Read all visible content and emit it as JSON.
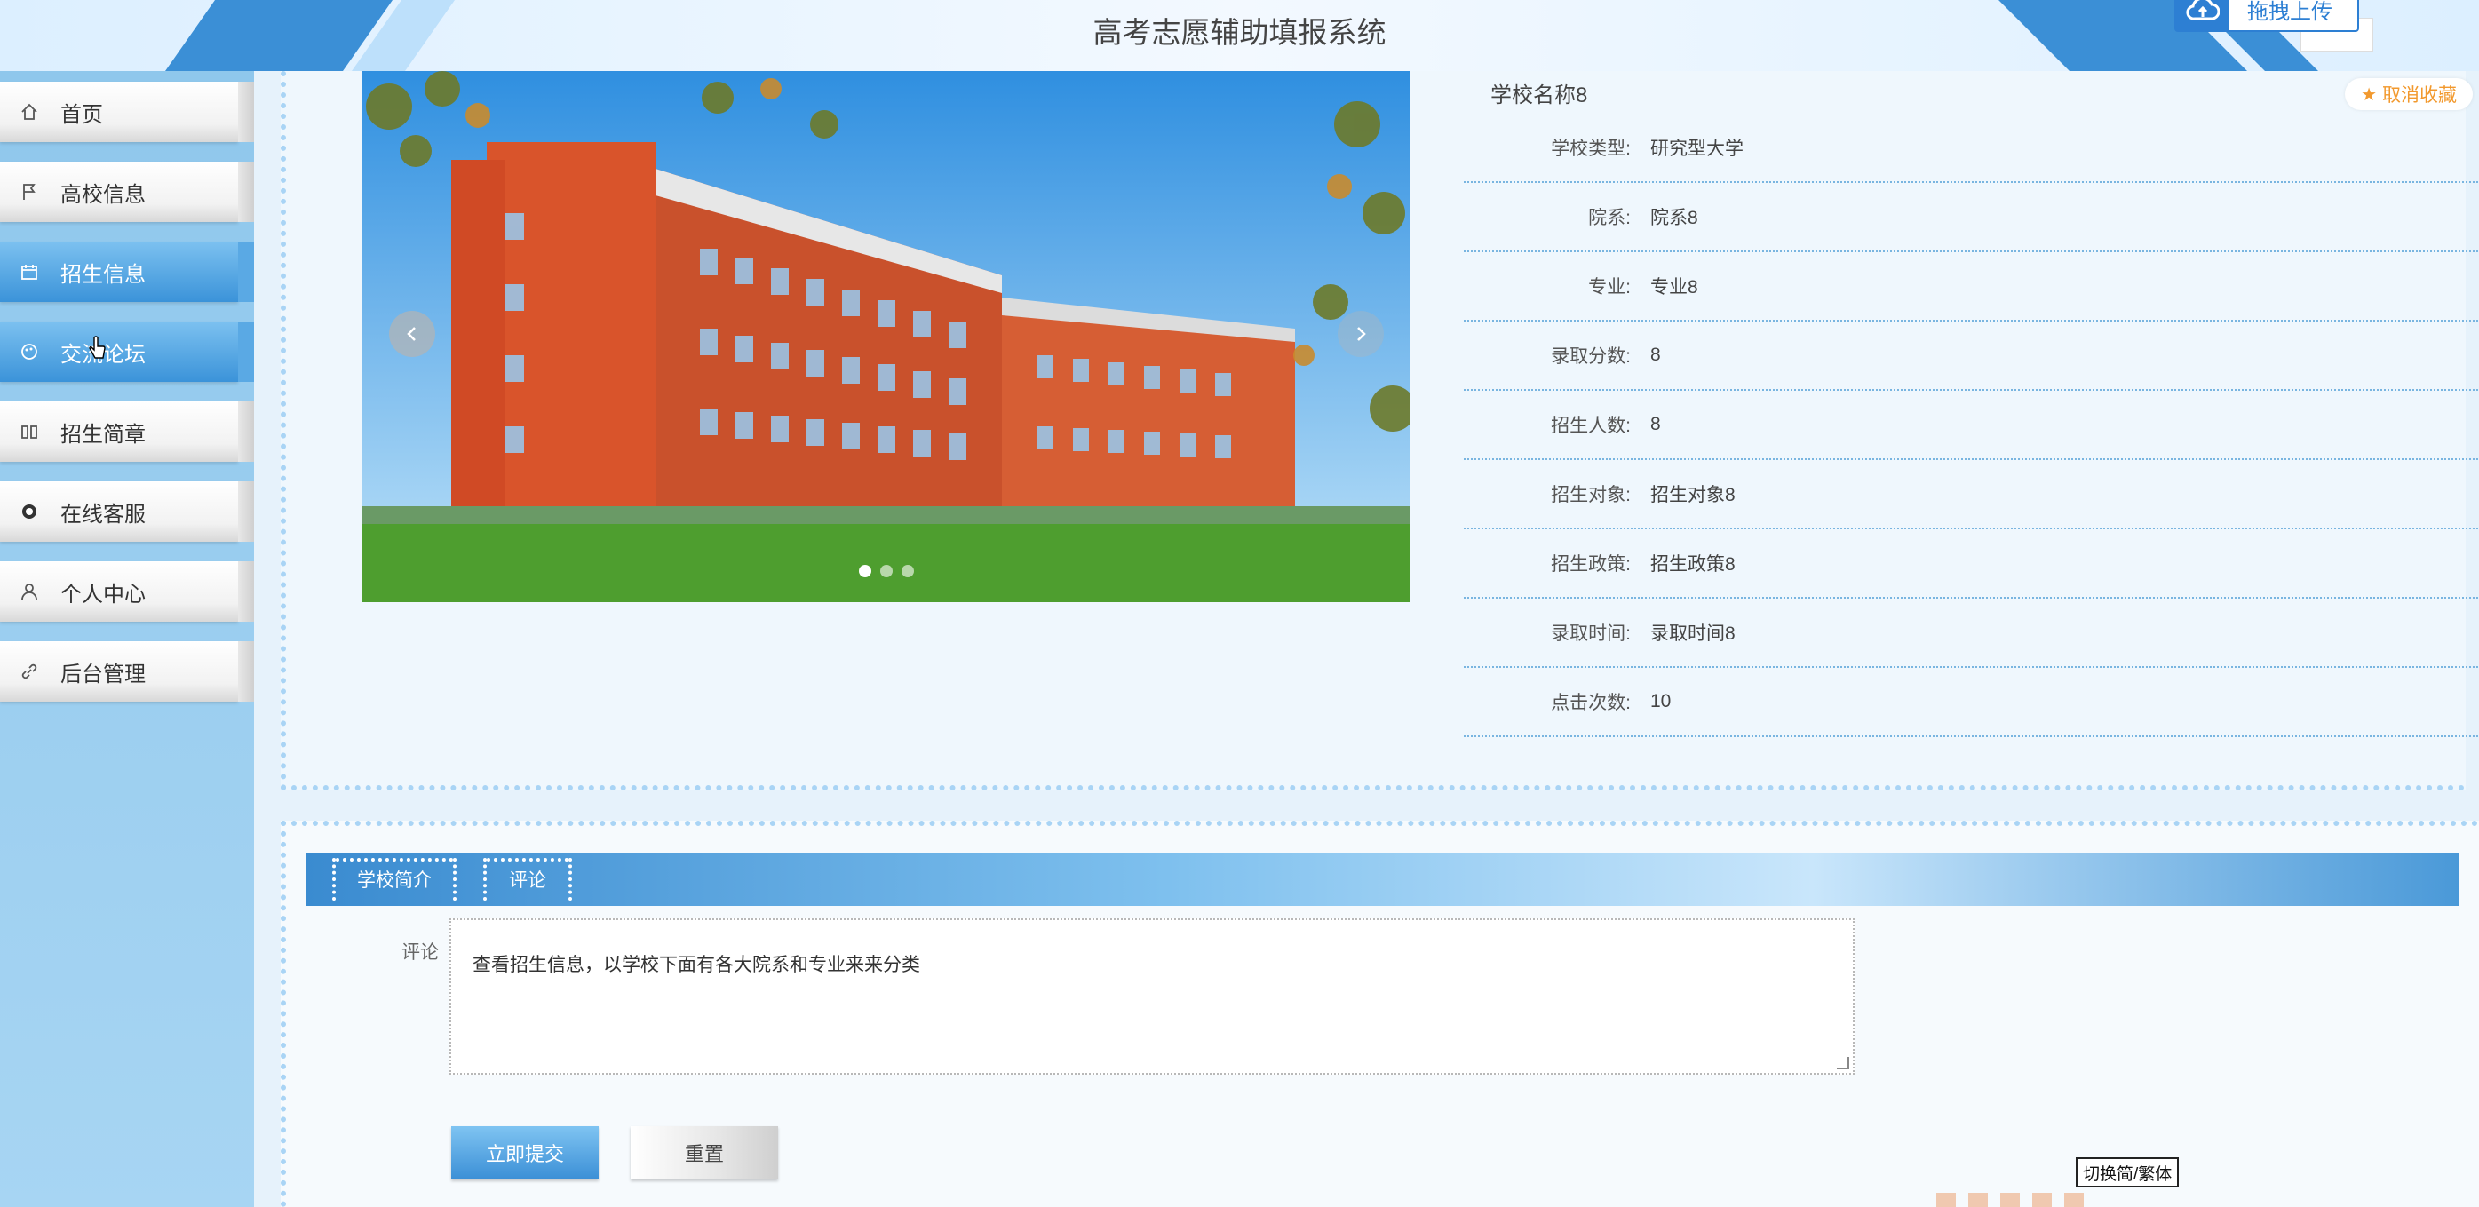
{
  "header": {
    "title": "高考志愿辅助填报系统",
    "upload_label": "拖拽上传"
  },
  "sidebar": {
    "items": [
      {
        "label": "首页",
        "icon": "home-icon"
      },
      {
        "label": "高校信息",
        "icon": "flag-icon"
      },
      {
        "label": "招生信息",
        "icon": "calendar-icon",
        "active": true
      },
      {
        "label": "交流论坛",
        "icon": "palette-icon"
      },
      {
        "label": "招生简章",
        "icon": "book-icon"
      },
      {
        "label": "在线客服",
        "icon": "chat-icon"
      },
      {
        "label": "个人中心",
        "icon": "user-icon"
      },
      {
        "label": "后台管理",
        "icon": "link-icon"
      }
    ]
  },
  "carousel": {
    "slide_count": 3,
    "active_index": 0
  },
  "school": {
    "name": "学校名称8",
    "fav_label": "取消收藏",
    "fields": [
      {
        "key": "学校类型:",
        "value": "研究型大学"
      },
      {
        "key": "院系:",
        "value": "院系8"
      },
      {
        "key": "专业:",
        "value": "专业8"
      },
      {
        "key": "录取分数:",
        "value": "8"
      },
      {
        "key": "招生人数:",
        "value": "8"
      },
      {
        "key": "招生对象:",
        "value": "招生对象8"
      },
      {
        "key": "招生政策:",
        "value": "招生政策8"
      },
      {
        "key": "录取时间:",
        "value": "录取时间8"
      },
      {
        "key": "点击次数:",
        "value": "10"
      }
    ]
  },
  "tabs": {
    "intro": "学校简介",
    "comment": "评论"
  },
  "comment_form": {
    "label": "评论",
    "value": "查看招生信息，以学校下面有各大院系和专业来来分类",
    "submit_label": "立即提交",
    "reset_label": "重置"
  },
  "lang_toggle": "切换简/繁体",
  "colors": {
    "accent": "#3b8fd6",
    "favorite": "#f2992e",
    "sidebar": "#8fc7ec"
  }
}
